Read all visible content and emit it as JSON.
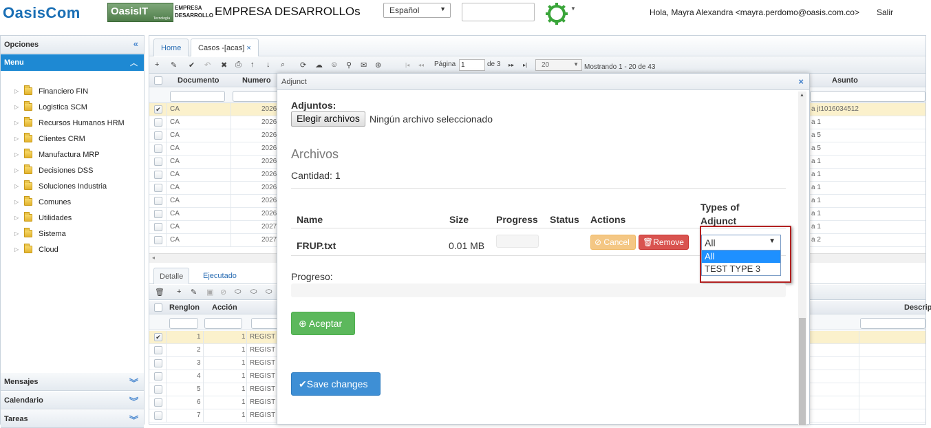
{
  "header": {
    "logo_oasiscom": "OasisCom",
    "logo_oasisit": "OasisIT",
    "logo_oasisit_sub": "Tecnología",
    "empresa_line1": "EMPRESA",
    "empresa_line2": "DESARROLLO",
    "company_title": "EMPRESA DESARROLLOs",
    "language": "Español",
    "greeting": "Hola, Mayra Alexandra <mayra.perdomo@oasis.com.co>",
    "logout": "Salir"
  },
  "sidebar": {
    "opciones": "Opciones",
    "menu": "Menu",
    "items": [
      {
        "label": "Financiero FIN"
      },
      {
        "label": "Logistica SCM"
      },
      {
        "label": "Recursos Humanos HRM"
      },
      {
        "label": "Clientes CRM"
      },
      {
        "label": "Manufactura MRP"
      },
      {
        "label": "Decisiones DSS"
      },
      {
        "label": "Soluciones Industria"
      },
      {
        "label": "Comunes"
      },
      {
        "label": "Utilidades"
      },
      {
        "label": "Sistema"
      },
      {
        "label": "Cloud"
      }
    ],
    "mensajes": "Mensajes",
    "calendario": "Calendario",
    "tareas": "Tareas"
  },
  "tabs": {
    "home": "Home",
    "casos": "Casos -[acas]",
    "close": "×"
  },
  "toolbar": {
    "pagina_label": "Página",
    "page": "1",
    "of_pages": "de 3",
    "page_size": "20",
    "showing": "Mostrando 1 - 20 de 43"
  },
  "grid": {
    "headers": {
      "documento": "Documento",
      "numero": "Numero",
      "asunto": "Asunto"
    },
    "rows": [
      {
        "doc": "CA",
        "num": "2026",
        "asunto": "a jt1016034512",
        "checked": "✔"
      },
      {
        "doc": "CA",
        "num": "2026",
        "asunto": "a 1",
        "checked": ""
      },
      {
        "doc": "CA",
        "num": "2026",
        "asunto": "a 5",
        "checked": ""
      },
      {
        "doc": "CA",
        "num": "2026",
        "asunto": "a 5",
        "checked": ""
      },
      {
        "doc": "CA",
        "num": "2026",
        "asunto": "a 1",
        "checked": ""
      },
      {
        "doc": "CA",
        "num": "2026",
        "asunto": "a 1",
        "checked": ""
      },
      {
        "doc": "CA",
        "num": "2026",
        "asunto": "a 1",
        "checked": ""
      },
      {
        "doc": "CA",
        "num": "2026",
        "asunto": "a 1",
        "checked": ""
      },
      {
        "doc": "CA",
        "num": "2026",
        "asunto": "a 1",
        "checked": ""
      },
      {
        "doc": "CA",
        "num": "2027",
        "asunto": "a 1",
        "checked": ""
      },
      {
        "doc": "CA",
        "num": "2027",
        "asunto": "a 2",
        "checked": ""
      }
    ]
  },
  "subtabs": {
    "detalle": "Detalle",
    "ejecutado": "Ejecutado"
  },
  "grid2": {
    "headers": {
      "renglon": "Renglon",
      "accion": "Acción",
      "descrip": "Descrip"
    },
    "rows": [
      {
        "renglon": "1",
        "accion": "1",
        "text": "REGIST",
        "checked": "✔"
      },
      {
        "renglon": "2",
        "accion": "1",
        "text": "REGIST",
        "checked": ""
      },
      {
        "renglon": "3",
        "accion": "1",
        "text": "REGIST",
        "checked": ""
      },
      {
        "renglon": "4",
        "accion": "1",
        "text": "REGIST",
        "checked": ""
      },
      {
        "renglon": "5",
        "accion": "1",
        "text": "REGIST",
        "checked": ""
      },
      {
        "renglon": "6",
        "accion": "1",
        "text": "REGIST",
        "checked": ""
      },
      {
        "renglon": "7",
        "accion": "1",
        "text": "REGIST",
        "checked": ""
      }
    ]
  },
  "modal": {
    "title": "Adjunct",
    "close": "×",
    "adjuntos_label": "Adjuntos:",
    "choose_files": "Elegir archivos",
    "no_file": "Ningún archivo seleccionado",
    "archivos": "Archivos",
    "cantidad": "Cantidad: 1",
    "table_headers": {
      "name": "Name",
      "size": "Size",
      "progress": "Progress",
      "status": "Status",
      "actions": "Actions",
      "types_line1": "Types of",
      "types_line2": "Adjunct"
    },
    "file": {
      "name": "FRUP.txt",
      "size": "0.01 MB",
      "status": ""
    },
    "cancel": "Cancel",
    "remove": "Remove",
    "type_selected": "All",
    "type_options": [
      "All",
      "TEST TYPE 3"
    ],
    "progreso": "Progreso:",
    "aceptar": "Aceptar",
    "save_changes": "Save changes"
  },
  "colors": {
    "accent": "#1e89d3",
    "success": "#5cb85c",
    "danger": "#d9534f",
    "warning": "#f4c784",
    "primary": "#3e8fd5"
  }
}
